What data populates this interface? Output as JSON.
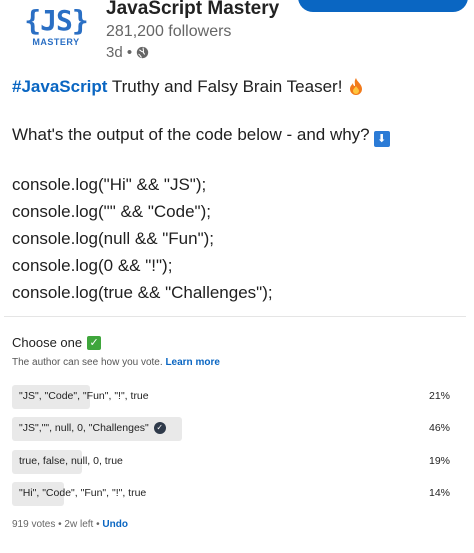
{
  "author": {
    "logo_mark": "{JS}",
    "logo_text": "MASTERY",
    "name": "JavaScript Mastery",
    "followers": "281,200 followers",
    "time": "3d •"
  },
  "post": {
    "hashtag": "#JavaScript",
    "title_rest": " Truthy and Falsy Brain Teaser!",
    "question": "What's the output of the code below - and why?",
    "down_arrow": "⬇",
    "code": [
      "console.log(\"Hi\" && \"JS\");",
      "console.log(\"\" && \"Code\");",
      "console.log(null && \"Fun\");",
      "console.log(0 && \"!\");",
      "console.log(true && \"Challenges\");"
    ]
  },
  "poll": {
    "title": "Choose one",
    "note_text": "The author can see how you vote.",
    "note_link": "Learn more",
    "options": [
      {
        "label": "\"JS\", \"Code\", \"Fun\", \"!\", true",
        "percent": "21%",
        "fraction": 0.21,
        "selected": false
      },
      {
        "label": "\"JS\",\"\", null, 0, \"Challenges\"",
        "percent": "46%",
        "fraction": 0.46,
        "selected": true
      },
      {
        "label": "true, false, null, 0, true",
        "percent": "19%",
        "fraction": 0.19,
        "selected": false
      },
      {
        "label": "\"Hi\", \"Code\", \"Fun\", \"!\", true",
        "percent": "14%",
        "fraction": 0.14,
        "selected": false
      }
    ],
    "votes": "919 votes • 2w left •",
    "undo": "Undo"
  },
  "colors": {
    "accent": "#0a66c2",
    "bar_fill": "#e9e9e9",
    "check": "#3fa63c"
  }
}
